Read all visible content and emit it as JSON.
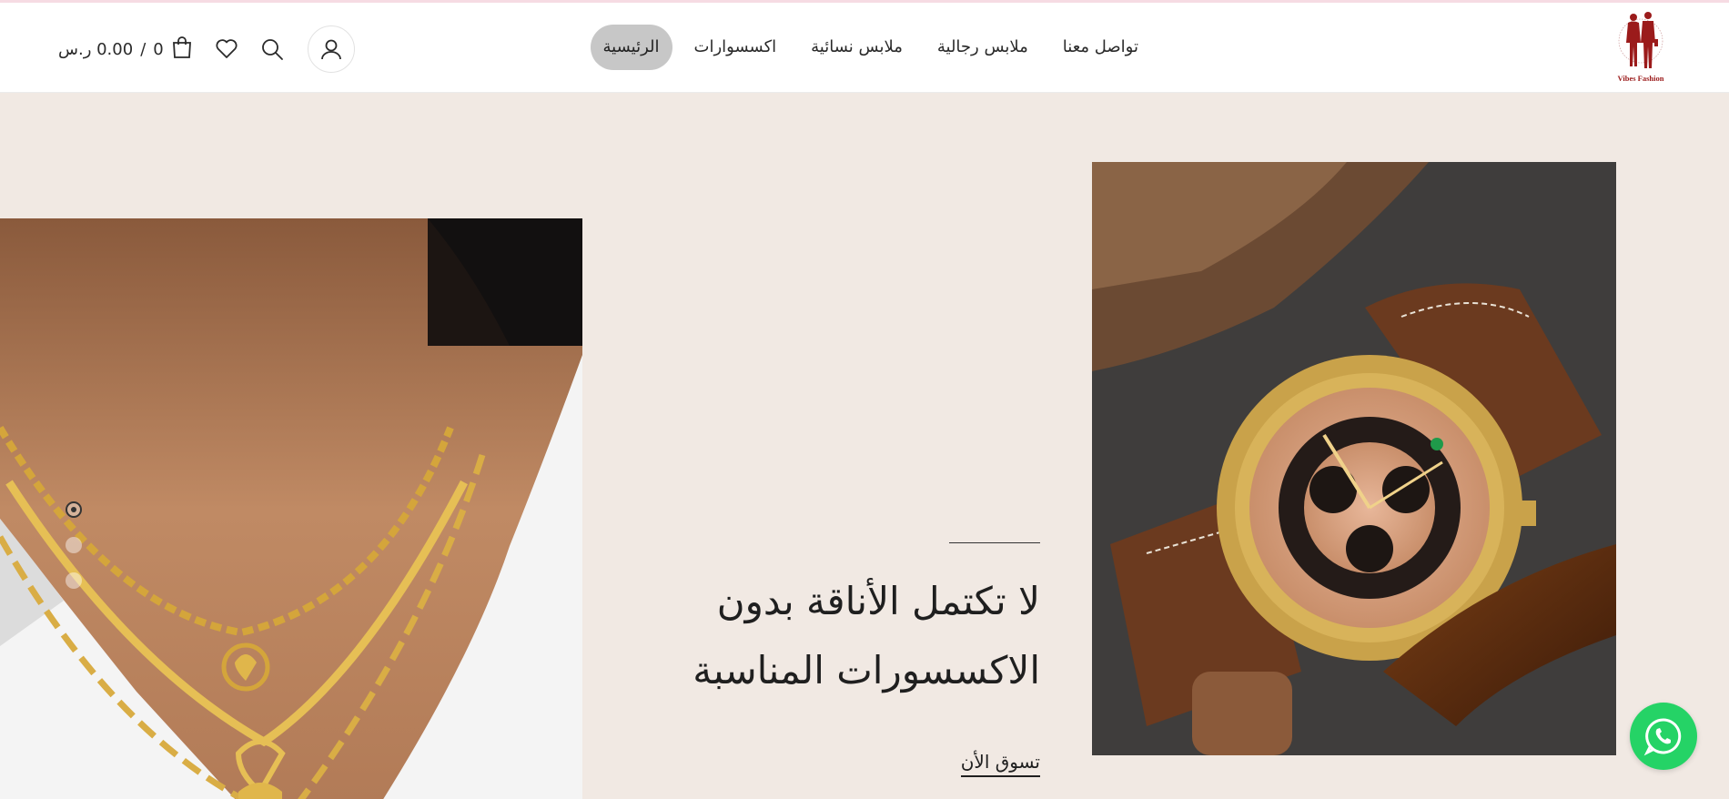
{
  "brand": {
    "logo_text": "Vibes Fashion",
    "accent_color": "#9b1b1b"
  },
  "nav": {
    "items": [
      {
        "label": "الرئيسية",
        "active": true
      },
      {
        "label": "اكسسوارات",
        "active": false
      },
      {
        "label": "ملابس نسائية",
        "active": false
      },
      {
        "label": "ملابس رجالية",
        "active": false
      },
      {
        "label": "تواصل معنا",
        "active": false
      }
    ]
  },
  "header_tools": {
    "cart_total": "0.00 ر.س",
    "cart_separator": "/",
    "cart_count": "0",
    "icons": [
      "cart-icon",
      "heart-icon",
      "search-icon",
      "user-icon"
    ]
  },
  "hero": {
    "title_line1": "لا تكتمل الأناقة بدون",
    "title_line2": "الاكسسورات المناسبة",
    "cta": "تسوق الأن",
    "background_color": "#f1e9e3",
    "slides": 3,
    "active_slide": 1
  },
  "whatsapp": {
    "color": "#25d366",
    "icon": "whatsapp-icon"
  }
}
